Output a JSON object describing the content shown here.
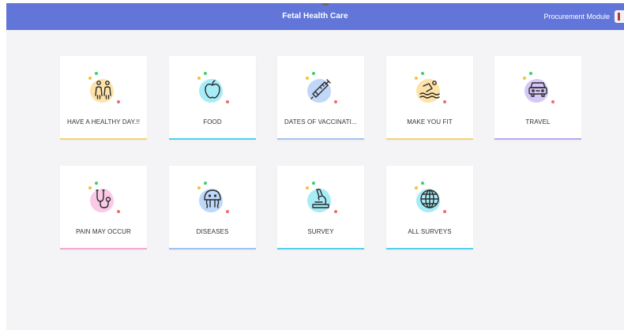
{
  "header": {
    "title": "Fetal Health Care",
    "module": "Procurement Module"
  },
  "cards": [
    {
      "label": "HAVE A HEALTHY DAY.!!",
      "icon": "family-icon",
      "bar_color": "#f6d27c",
      "blob_color": "#fde3a9"
    },
    {
      "label": "FOOD",
      "icon": "apple-icon",
      "bar_color": "#52d0ea",
      "blob_color": "#a7ecf7"
    },
    {
      "label": "DATES OF VACCINATI...",
      "icon": "syringe-icon",
      "bar_color": "#a7c2f0",
      "blob_color": "#c2d6f8"
    },
    {
      "label": "MAKE YOU FIT",
      "icon": "swimmer-icon",
      "bar_color": "#f6d27c",
      "blob_color": "#fde3a9"
    },
    {
      "label": "TRAVEL",
      "icon": "car-icon",
      "bar_color": "#bba5ef",
      "blob_color": "#d6c8f6"
    },
    {
      "label": "PAIN MAY OCCUR",
      "icon": "stethoscope-icon",
      "bar_color": "#f6a6d8",
      "blob_color": "#f9c9e6"
    },
    {
      "label": "DISEASES",
      "icon": "jellyfish-icon",
      "bar_color": "#9dc3f4",
      "blob_color": "#bdd8f8"
    },
    {
      "label": "SURVEY",
      "icon": "microscope-icon",
      "bar_color": "#52d0ea",
      "blob_color": "#a7ecf7"
    },
    {
      "label": "ALL SURVEYS",
      "icon": "globe-icon",
      "bar_color": "#52d0ea",
      "blob_color": "#a7ecf7"
    }
  ]
}
